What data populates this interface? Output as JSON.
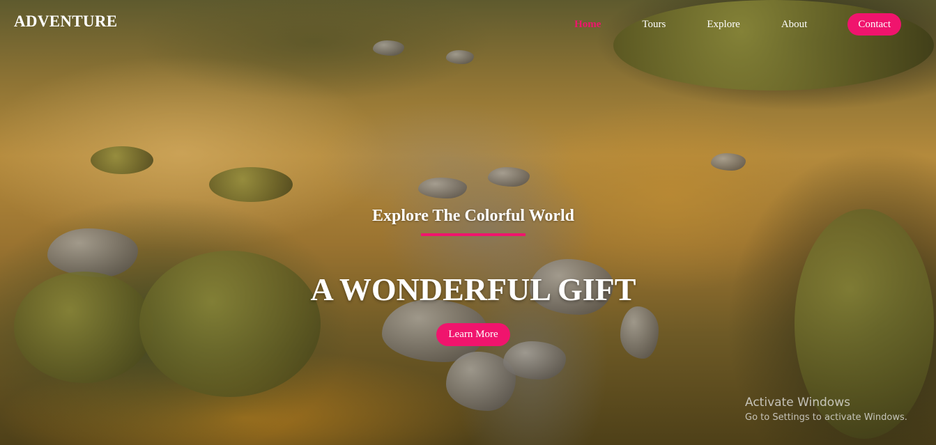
{
  "brand": {
    "name": "ADVENTURE"
  },
  "nav": {
    "items": [
      {
        "label": "Home",
        "active": true
      },
      {
        "label": "Tours",
        "active": false
      },
      {
        "label": "Explore",
        "active": false
      },
      {
        "label": "About",
        "active": false
      }
    ],
    "contact_label": "Contact"
  },
  "hero": {
    "subtitle": "Explore The Colorful World",
    "headline": "A WONDERFUL GIFT",
    "cta_label": "Learn More"
  },
  "watermark": {
    "title": "Activate Windows",
    "subtitle": "Go to Settings to activate Windows."
  },
  "colors": {
    "accent": "#f0146d",
    "text": "#ffffff"
  }
}
